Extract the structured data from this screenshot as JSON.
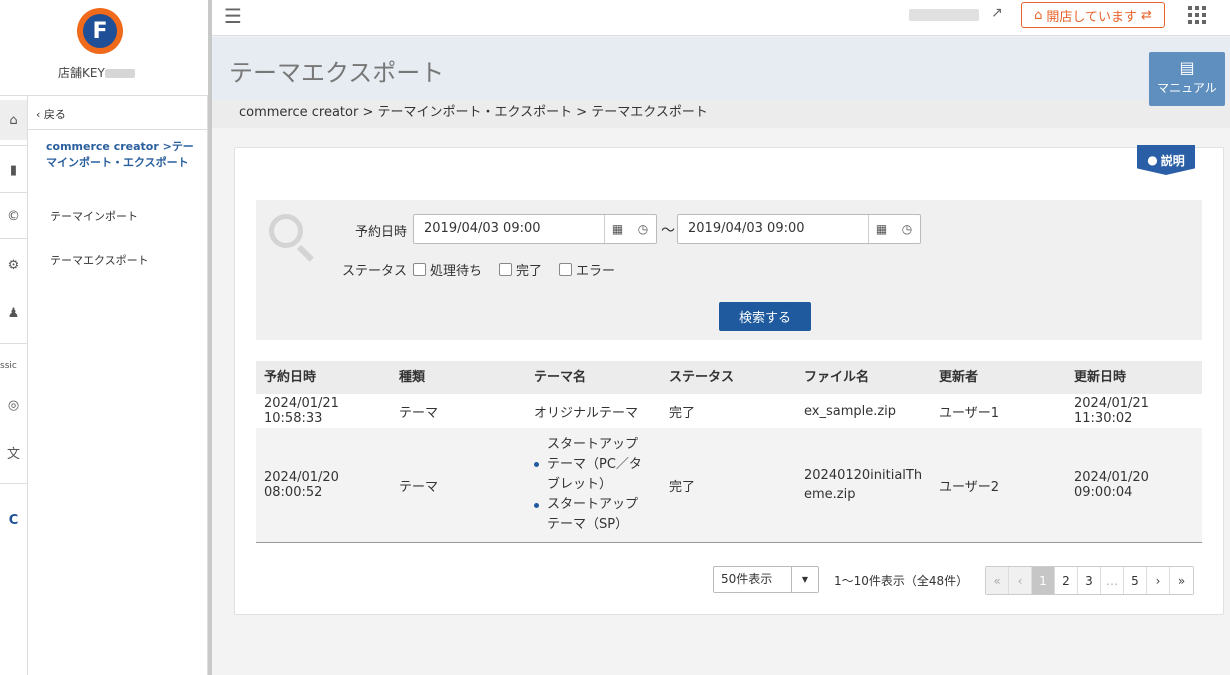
{
  "sidebar": {
    "store_key_label": "店舗KEY",
    "back_label": "戻る",
    "section_title": "commerce creator >テーマインポート・エクスポート",
    "items": [
      {
        "label": "テーマインポート"
      },
      {
        "label": "テーマエクスポート"
      }
    ],
    "rail_classic_label": "lassic"
  },
  "topbar": {
    "open_status_label": "開店しています"
  },
  "page": {
    "title": "テーマエクスポート",
    "manual_label": "マニュアル",
    "breadcrumb": "commerce creator > テーマインポート・エクスポート > テーマエクスポート",
    "explain_label": "説明"
  },
  "search": {
    "date_label": "予約日時",
    "date_from": "2019/04/03 09:00",
    "date_to": "2019/04/03 09:00",
    "range_sep": "～",
    "status_label": "ステータス",
    "status_options": [
      "処理待ち",
      "完了",
      "エラー"
    ],
    "submit_label": "検索する"
  },
  "table": {
    "headers": [
      "予約日時",
      "種類",
      "テーマ名",
      "ステータス",
      "ファイル名",
      "更新者",
      "更新日時"
    ],
    "rows": [
      {
        "reserved": "2024/01/21 10:58:33",
        "type": "テーマ",
        "theme": "オリジナルテーマ",
        "status": "完了",
        "file": "ex_sample.zip",
        "user": "ユーザー1",
        "updated": "2024/01/21 11:30:02"
      },
      {
        "reserved": "2024/01/20 08:00:52",
        "type": "テーマ",
        "themes": [
          "スタートアップテーマ（PC／タブレット）",
          "スタートアップテーマ（SP）"
        ],
        "status": "完了",
        "file": "20240120initialTheme.zip",
        "user": "ユーザー2",
        "updated": "2024/01/20 09:00:04"
      }
    ]
  },
  "pagination": {
    "per_page": "50件表示",
    "summary": "1～10件表示（全48件）",
    "pages": [
      "1",
      "2",
      "3",
      "…",
      "5"
    ],
    "current": "1"
  },
  "colors": {
    "accent_blue": "#1f5a9e",
    "brand_orange": "#e8632a"
  }
}
